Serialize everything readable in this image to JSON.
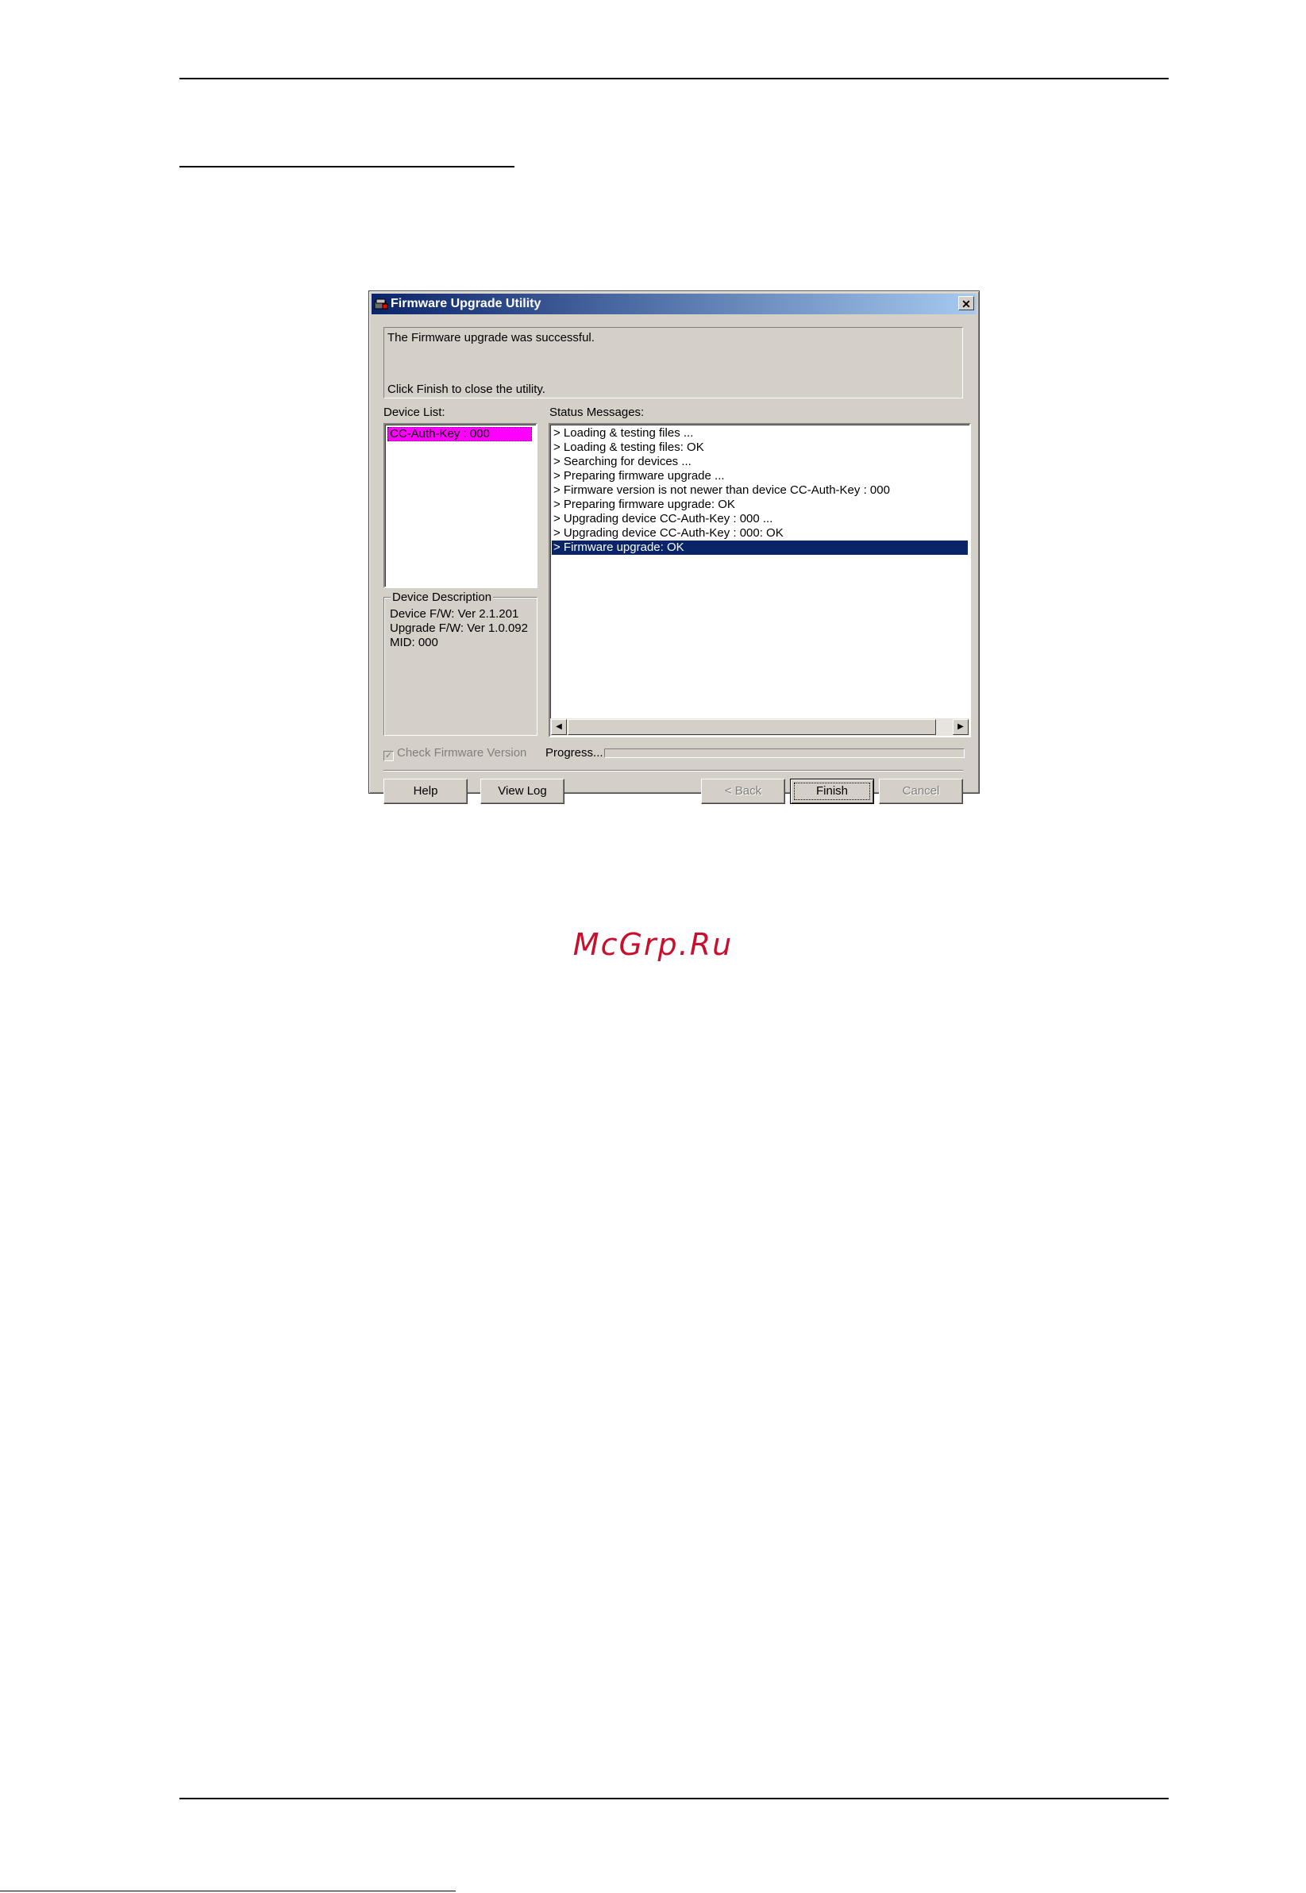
{
  "watermark": "McGrp.Ru",
  "dialog": {
    "title": "Firmware Upgrade Utility",
    "close_glyph": "✕",
    "message_line1": "The Firmware upgrade was successful.",
    "message_line2": "Click Finish to close the utility.",
    "device_list_label": "Device List:",
    "device_items": [
      "CC-Auth-Key : 000"
    ],
    "device_description": {
      "legend": "Device Description",
      "lines": [
        "Device F/W: Ver 2.1.201",
        "Upgrade F/W: Ver 1.0.092",
        "MID: 000"
      ]
    },
    "status_label": "Status Messages:",
    "status_messages": [
      "> Loading & testing files ...",
      "> Loading & testing files: OK",
      "> Searching for devices ...",
      "> Preparing firmware upgrade ...",
      "> Firmware version is not newer than device CC-Auth-Key : 000",
      "> Preparing firmware upgrade: OK",
      "> Upgrading device CC-Auth-Key : 000 ...",
      "> Upgrading device CC-Auth-Key : 000: OK",
      "> Firmware upgrade: OK"
    ],
    "selected_status_index": 8,
    "check_firmware_label": "Check Firmware Version",
    "check_firmware_checked": true,
    "progress_label": "Progress...",
    "progress_value": 0,
    "buttons": {
      "help": "Help",
      "view_log": "View Log",
      "back": "< Back",
      "finish": "Finish",
      "cancel": "Cancel"
    }
  },
  "colors": {
    "dialog_face": "#d4d0c8",
    "title_start": "#0a246a",
    "title_end": "#a6caf0",
    "device_highlight": "#ff00ff",
    "selection": "#0a246a",
    "watermark": "#c8102e"
  }
}
